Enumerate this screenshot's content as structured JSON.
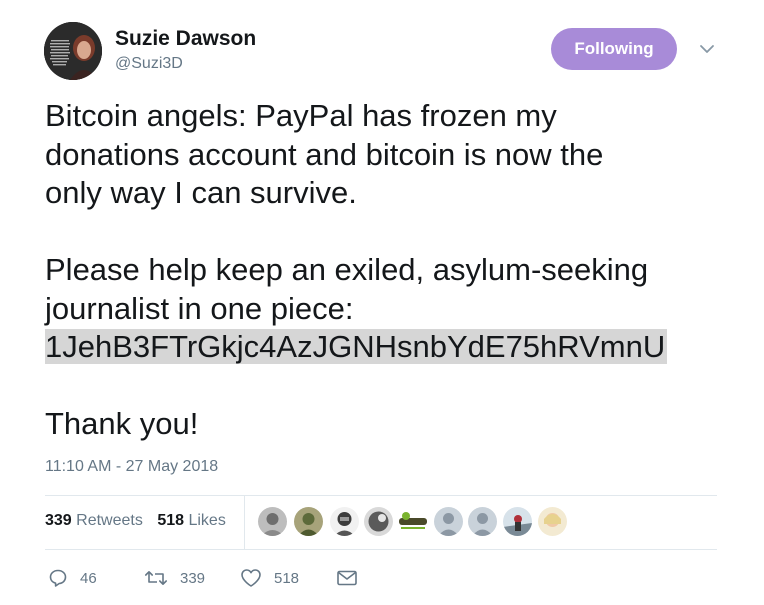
{
  "author": {
    "name": "Suzie Dawson",
    "handle": "@Suzi3D"
  },
  "follow_button": {
    "label": "Following",
    "color": "#a88bd8"
  },
  "tweet": {
    "lines_para1": [
      "Bitcoin angels: PayPal has frozen my",
      "donations account and bitcoin is now the",
      "only way I can survive."
    ],
    "lines_para2": [
      "Please help keep an exiled, asylum-seeking",
      "journalist in one piece:"
    ],
    "bitcoin_address": "1JehB3FTrGkjc4AzJGNHsnbYdE75hRVmnU",
    "closing": "Thank you!"
  },
  "timestamp": "11:10 AM - 27 May 2018",
  "stats": {
    "retweets_count": "339",
    "retweets_label": "Retweets",
    "likes_count": "518",
    "likes_label": "Likes"
  },
  "liker_avatars": [
    "liker-avatar-1",
    "liker-avatar-2",
    "liker-avatar-3",
    "liker-avatar-4",
    "liker-avatar-5",
    "liker-avatar-6",
    "liker-avatar-7",
    "liker-avatar-8",
    "liker-avatar-9"
  ],
  "actions": {
    "reply_count": "46",
    "retweet_count": "339",
    "like_count": "518"
  },
  "icons": {
    "reply": "reply-icon",
    "retweet": "retweet-icon",
    "like": "heart-icon",
    "dm": "envelope-icon",
    "caret": "chevron-down-icon"
  },
  "colors": {
    "text_primary": "#14171a",
    "text_secondary": "#657786",
    "divider": "#e1e8ed",
    "highlight": "#d6d6d6"
  }
}
